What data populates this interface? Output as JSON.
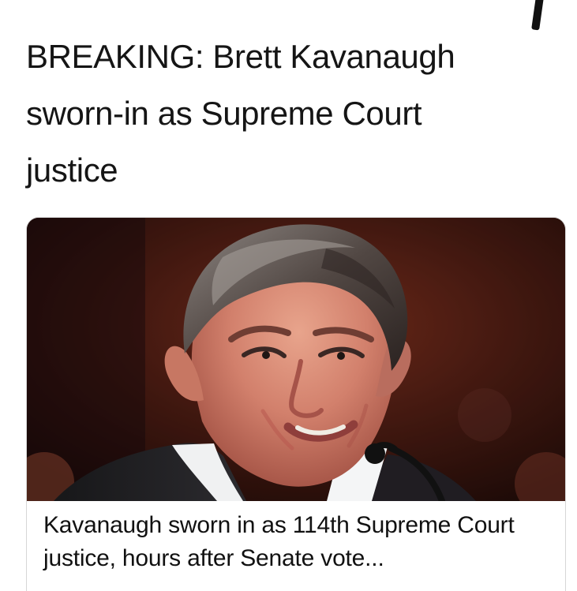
{
  "post": {
    "headline": "BREAKING: Brett Kavanaugh\nsworn-in as Supreme Court\njustice"
  },
  "link_card": {
    "image_icon": "portrait-photo",
    "caption": "Kavanaugh sworn in as 114th Supreme Court justice, hours after Senate vote..."
  },
  "colors": {
    "background": "#ffffff",
    "text": "#151515",
    "card_border": "#d6d6d6",
    "photo_background": "#3a1710"
  }
}
